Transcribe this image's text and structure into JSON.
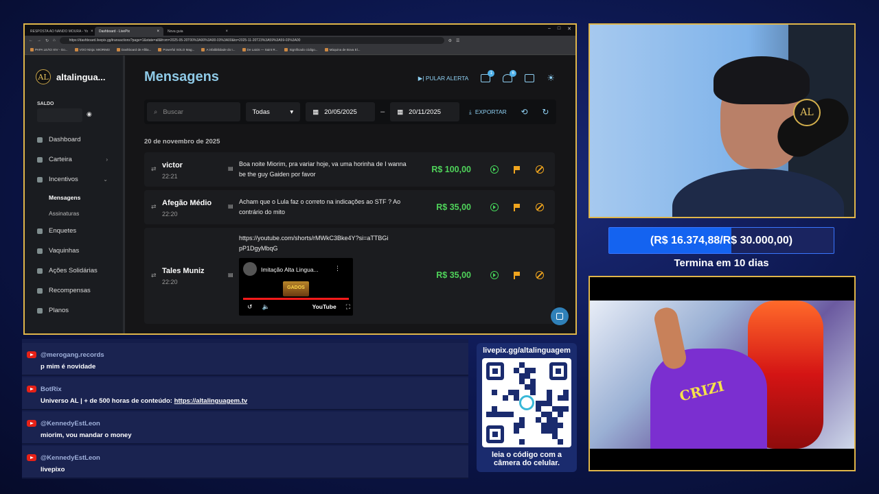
{
  "browser": {
    "tabs": [
      "RESPOSTA AO NANDO MOURA - Yo",
      "Dashboard - LivePix",
      "Nova guia"
    ],
    "url": "https://dashboard.livepix.gg/transactions?page=1&state=all&from=2025-05-20T00%3A00%3A00-03%3A00&to=2025-11-20T23%3A59%3A59-03%3A00",
    "bookmarks": [
      "PAPA LEÃO XIV - Go...",
      "VOO Ninja: MIORIM3",
      "Dashboard de Afilia...",
      "Powerful SOLO Mag...",
      "A infalibilidade do I...",
      "De Laicis — Saint R...",
      "Significado código...",
      "Máquina de Bova El..."
    ]
  },
  "sidebar": {
    "brand": "altalingua...",
    "brand_mark": "AL",
    "saldo_label": "SALDO",
    "items": [
      {
        "label": "Dashboard",
        "icon": "dashboard-icon"
      },
      {
        "label": "Carteira",
        "icon": "bank-icon"
      },
      {
        "label": "Incentivos",
        "icon": "sparkle-icon"
      },
      {
        "label": "Enquetes",
        "icon": "poll-icon"
      },
      {
        "label": "Vaquinhas",
        "icon": "piggy-icon"
      },
      {
        "label": "Ações Solidárias",
        "icon": "heart-hand-icon"
      },
      {
        "label": "Recompensas",
        "icon": "gift-icon"
      },
      {
        "label": "Planos",
        "icon": "plans-icon"
      }
    ],
    "subitems": [
      "Mensagens",
      "Assinaturas"
    ]
  },
  "main": {
    "title": "Mensagens",
    "skip_alert": "PULAR ALERTA",
    "badge_1": "1",
    "badge_2": "6",
    "search_placeholder": "Buscar",
    "filter_value": "Todas",
    "date_from": "20/05/2025",
    "date_sep": "–",
    "date_to": "20/11/2025",
    "export_label": "EXPORTAR",
    "day_label": "20 de novembro de 2025"
  },
  "messages": [
    {
      "name": "victor",
      "time": "22:21",
      "text": "Boa noite Miorim, pra variar hoje, va uma horinha de I wanna be the guy Gaiden por favor",
      "amount": "R$ 100,00"
    },
    {
      "name": "Afegão Médio",
      "time": "22:20",
      "text": "Acham que o Lula faz o correto na indicações ao STF ? Ao contrário do mito",
      "amount": "R$ 35,00"
    },
    {
      "name": "Tales Muniz",
      "time": "22:20",
      "text": "https://youtube.com/shorts/rMWkC3Bke4Y?si=aTTBGipP1DgyMbqG",
      "amount": "R$ 35,00"
    }
  ],
  "video": {
    "title": "Imitação Alta Lingua...",
    "brand": "YouTube",
    "thumb_text": "GADOS"
  },
  "goal": {
    "text": "(R$ 16.374,88/R$ 30.000,00)",
    "progress": 0.5458,
    "ends": "Termina em 10 dias"
  },
  "game_text": "CRIZI",
  "chat": [
    {
      "user": "@merogang.records",
      "text": "p mim é novidade"
    },
    {
      "user": "BotRix",
      "text": "Universo AL | + de 500 horas de conteúdo: ",
      "link": "https://altalinguagem.tv"
    },
    {
      "user": "@KennedyEstLeon",
      "text": "miorim, vou mandar o money"
    },
    {
      "user": "@KennedyEstLeon",
      "text": "livepixo"
    }
  ],
  "qr": {
    "title": "livepix.gg/altalinguagem",
    "caption_1": "leia o código com a",
    "caption_2": "câmera do celular."
  },
  "colors": {
    "accent": "#8ec9e6",
    "amount": "#4fd35a",
    "warn": "#f0a51e",
    "frame": "#e0b64a",
    "goal": "#1463f0"
  }
}
